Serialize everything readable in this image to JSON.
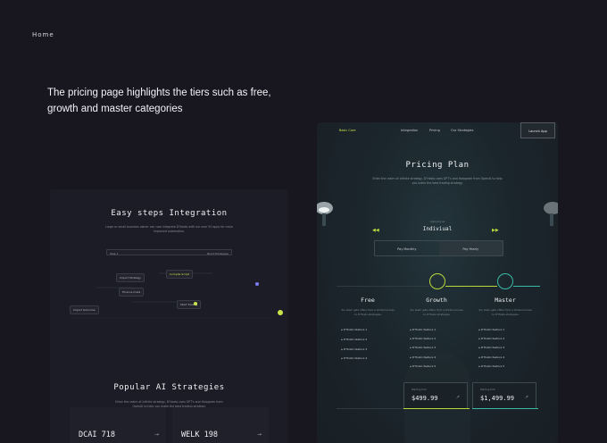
{
  "page": {
    "home_label": "Home",
    "headline": "The pricing page highlights the tiers such as free, growth and master categories"
  },
  "integration": {
    "title": "Easy steps Integration",
    "subtitle": "Large or small business owner can now integrate D'Hosto with our over 50 apps for more improved automation.",
    "bar_left": "Step 1",
    "bar_right": "Build Strategies",
    "node_a": "Import Strategy",
    "node_b": "Finance meta",
    "node_c": "Compile Script",
    "node_d": "Import Outcome",
    "node_e": "Start Trading",
    "footer_heading": "Popular AI Strategies",
    "footer_sub": "Enter the realm of infinite strategy, D'Hosto uses GPT's and Hologram from OpenAI to help you make the best trading strategy.",
    "strategies": [
      {
        "name": "DCAI 718"
      },
      {
        "name": "WELK 198"
      }
    ]
  },
  "pricing": {
    "logo": "Basic Core",
    "nav": [
      "Integration",
      "Pricing",
      "Our Strategies"
    ],
    "launch_label": "Launch App",
    "title": "Pricing Plan",
    "subtitle": "Enter the realm of infinite strategy, D'Hosto uses GPT's and Hologram from OpenAI to help you make the best trading strategy.",
    "switch_label": "Applying as",
    "switch_value": "Indiviual",
    "toggle_monthly": "Pay Monthly",
    "toggle_yearly": "Pay Yearly",
    "tier_desc": "You team gets offers from a limited access to D'Hosto strategies",
    "price_label": "Starting from",
    "tiers": [
      {
        "name": "Free",
        "features": [
          "D'Hosto feature 1",
          "D'Hosto feature 2",
          "D'Hosto feature 3",
          "D'Hosto feature 4"
        ]
      },
      {
        "name": "Growth",
        "features": [
          "D'Hosto feature 1",
          "D'Hosto feature 2",
          "D'Hosto feature 3",
          "D'Hosto feature 4",
          "D'Hosto feature 5"
        ],
        "price": "$499.99"
      },
      {
        "name": "Master",
        "features": [
          "D'Hosto feature 1",
          "D'Hosto feature 2",
          "D'Hosto feature 3",
          "D'Hosto feature 4",
          "D'Hosto feature 5"
        ],
        "price": "$1,499.99"
      }
    ],
    "colors": {
      "accent_lime": "#b9d83c",
      "accent_teal": "#3ab9a6"
    }
  }
}
